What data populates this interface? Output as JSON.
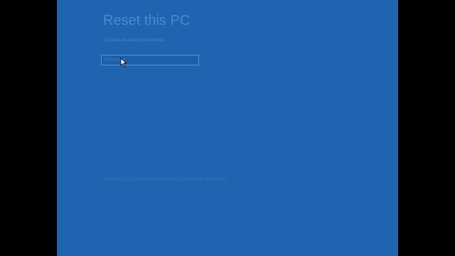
{
  "colors": {
    "background": "#1e64b0",
    "letterbox": "#000000",
    "faint_text": "#4f87c9"
  },
  "screen": {
    "title": "Reset this PC",
    "subtitle": "Choose an account to continue",
    "password_placeholder": "Password",
    "forgot_link": "Forgot your password or don't use your account?"
  },
  "cursor_icon": "arrow-pointer"
}
